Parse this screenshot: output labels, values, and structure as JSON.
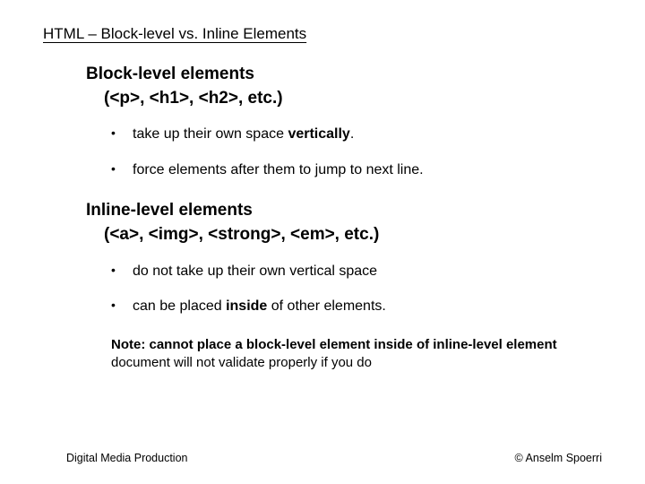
{
  "title": "HTML – Block-level vs. Inline Elements",
  "block": {
    "heading_line1": "Block-level elements",
    "heading_line2": "(<p>, <h1>, <h2>, etc.)",
    "bullets": [
      {
        "pre": "take up their own space ",
        "bold": "vertically",
        "post": "."
      },
      {
        "pre": "force elements after them to jump to next line.",
        "bold": "",
        "post": ""
      }
    ]
  },
  "inline": {
    "heading_line1": "Inline-level elements",
    "heading_line2": "(<a>, <img>, <strong>, <em>, etc.)",
    "bullets": [
      {
        "pre": "do not take up their own vertical space",
        "bold": "",
        "post": ""
      },
      {
        "pre": "can be placed ",
        "bold": "inside",
        "post": " of other elements."
      }
    ]
  },
  "note": {
    "prefix": "Note: ",
    "main": "cannot place a block-level element inside of inline-level element",
    "sub": "document will not validate properly if you do"
  },
  "footer": {
    "left": "Digital Media Production",
    "right": "© Anselm Spoerri"
  }
}
